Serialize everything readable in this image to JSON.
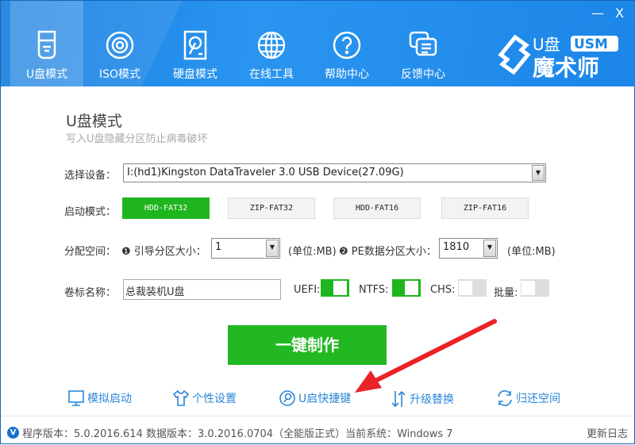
{
  "window": {
    "minimize": "—",
    "close": "X"
  },
  "tabs": [
    {
      "label": "U盘模式"
    },
    {
      "label": "ISO模式"
    },
    {
      "label": "硬盘模式"
    },
    {
      "label": "在线工具"
    },
    {
      "label": "帮助中心"
    },
    {
      "label": "反馈中心"
    }
  ],
  "logo": {
    "text": "U盘USM魔术师"
  },
  "main": {
    "title": "U盘模式",
    "subtitle": "写入U盘隐藏分区防止病毒破坏",
    "device_label": "选择设备：",
    "device_value": "I:(hd1)Kingston DataTraveler 3.0 USB Device(27.09G)",
    "boot_label": "启动模式：",
    "boot_modes": [
      "HDD-FAT32",
      "ZIP-FAT32",
      "HDD-FAT16",
      "ZIP-FAT16"
    ],
    "boot_selected": "HDD-FAT32",
    "alloc_label": "分配空间：",
    "boot_part_label": "❶ 引导分区大小：",
    "boot_part_value": "1",
    "unit1": "(单位:MB)",
    "pe_part_label": "❷ PE数据分区大小：",
    "pe_part_value": "1810",
    "unit2": "(单位:MB)",
    "volume_label": "卷标名称：",
    "volume_value": "总裁装机U盘",
    "toggles": [
      {
        "label": "UEFI:",
        "on": true
      },
      {
        "label": "NTFS:",
        "on": true
      },
      {
        "label": "CHS:",
        "on": false
      },
      {
        "label": "批量:",
        "on": false
      }
    ],
    "make_button": "一键制作"
  },
  "links": [
    "模拟启动",
    "个性设置",
    "U启快捷键",
    "升级替换",
    "归还空间"
  ],
  "status": {
    "badge": "V",
    "text": "程序版本：5.0.2016.614  数据版本：3.0.2016.0704（全能版正式）当前系统：Windows 7",
    "log": "更新日志"
  },
  "colors": {
    "header": "#1a86e8",
    "accent": "#22b822",
    "link": "#2a86d8"
  }
}
